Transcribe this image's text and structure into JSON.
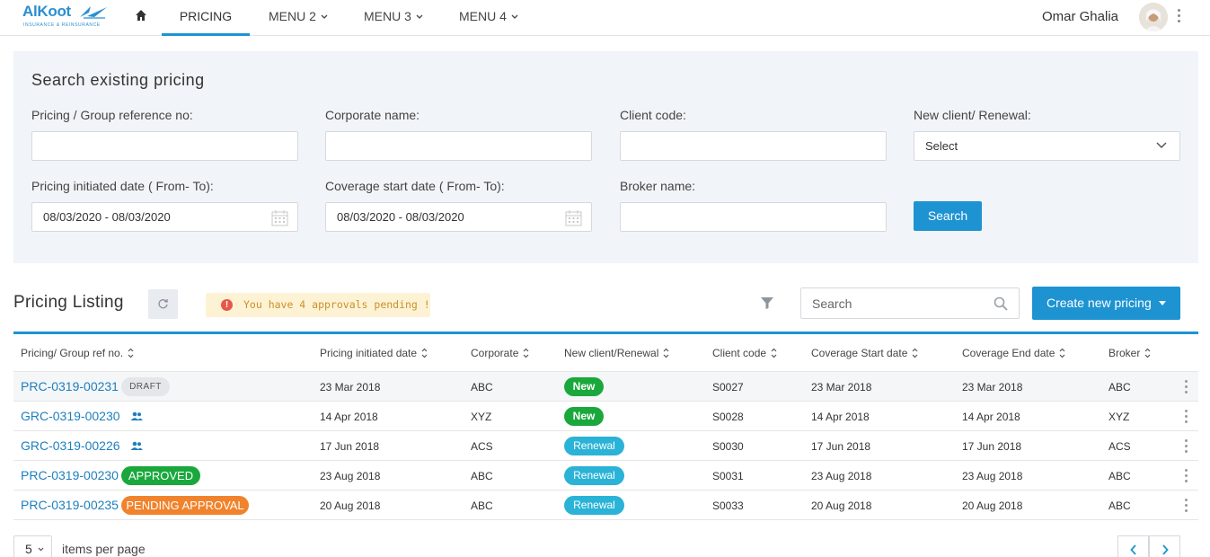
{
  "nav": {
    "logo_text": "AlKoot",
    "logo_subtext": "INSURANCE & REINSURANCE",
    "items": [
      {
        "label": "PRICING",
        "active": true
      },
      {
        "label": "MENU 2",
        "active": false
      },
      {
        "label": "MENU 3",
        "active": false
      },
      {
        "label": "MENU 4",
        "active": false
      }
    ],
    "user_name": "Omar Ghalia"
  },
  "search_panel": {
    "title": "Search existing pricing",
    "fields": {
      "pricing_ref": {
        "label": "Pricing / Group reference no:",
        "value": ""
      },
      "corporate_name": {
        "label": "Corporate name:",
        "value": ""
      },
      "client_code": {
        "label": "Client code:",
        "value": ""
      },
      "client_type": {
        "label": "New client/ Renewal:",
        "value": "Select"
      },
      "initiated_date": {
        "label": "Pricing initiated date ( From- To):",
        "value": "08/03/2020 - 08/03/2020"
      },
      "coverage_date": {
        "label": "Coverage start date ( From- To):",
        "value": "08/03/2020 - 08/03/2020"
      },
      "broker_name": {
        "label": "Broker name:",
        "value": ""
      }
    },
    "search_button": "Search"
  },
  "listing": {
    "title": "Pricing Listing",
    "alert_text": "You have 4 approvals pending !",
    "search_placeholder": "Search",
    "create_button": "Create new pricing",
    "columns": [
      "Pricing/ Group ref no.",
      "Pricing initiated date",
      "Corporate",
      "New client/Renewal",
      "Client code",
      "Coverage Start date",
      "Coverage End date",
      "Broker"
    ],
    "rows": [
      {
        "ref": "PRC-0319-00231",
        "tag": "DRAFT",
        "tag_type": "draft",
        "initiated": "23 Mar 2018",
        "corporate": "ABC",
        "client_type": "New",
        "client_code": "S0027",
        "cov_start": "23 Mar 2018",
        "cov_end": "23 Mar 2018",
        "broker": "ABC"
      },
      {
        "ref": "GRC-0319-00230",
        "tag": "",
        "tag_type": "group",
        "initiated": "14 Apr 2018",
        "corporate": "XYZ",
        "client_type": "New",
        "client_code": "S0028",
        "cov_start": "14 Apr 2018",
        "cov_end": "14 Apr 2018",
        "broker": "XYZ"
      },
      {
        "ref": "GRC-0319-00226",
        "tag": "",
        "tag_type": "group",
        "initiated": "17 Jun 2018",
        "corporate": "ACS",
        "client_type": "Renewal",
        "client_code": "S0030",
        "cov_start": "17 Jun 2018",
        "cov_end": "17 Jun 2018",
        "broker": "ACS"
      },
      {
        "ref": "PRC-0319-00230",
        "tag": "APPROVED",
        "tag_type": "approved",
        "initiated": "23 Aug 2018",
        "corporate": "ABC",
        "client_type": "Renewal",
        "client_code": "S0031",
        "cov_start": "23 Aug 2018",
        "cov_end": "23 Aug 2018",
        "broker": "ABC"
      },
      {
        "ref": "PRC-0319-00235",
        "tag": "PENDING APPROVAL",
        "tag_type": "pending",
        "initiated": "20 Aug 2018",
        "corporate": "ABC",
        "client_type": "Renewal",
        "client_code": "S0033",
        "cov_start": "20 Aug 2018",
        "cov_end": "20 Aug 2018",
        "broker": "ABC"
      }
    ]
  },
  "pagination": {
    "per_page": "5",
    "per_page_label": "items per page"
  },
  "colors": {
    "primary": "#1e93d2",
    "link": "#1e7fbe",
    "panel_bg": "#f1f4f8",
    "new_badge": "#1aa83c",
    "renewal_badge": "#2ab3d6",
    "pending_badge": "#f0832c",
    "alert_bg": "#fdf3d4"
  }
}
